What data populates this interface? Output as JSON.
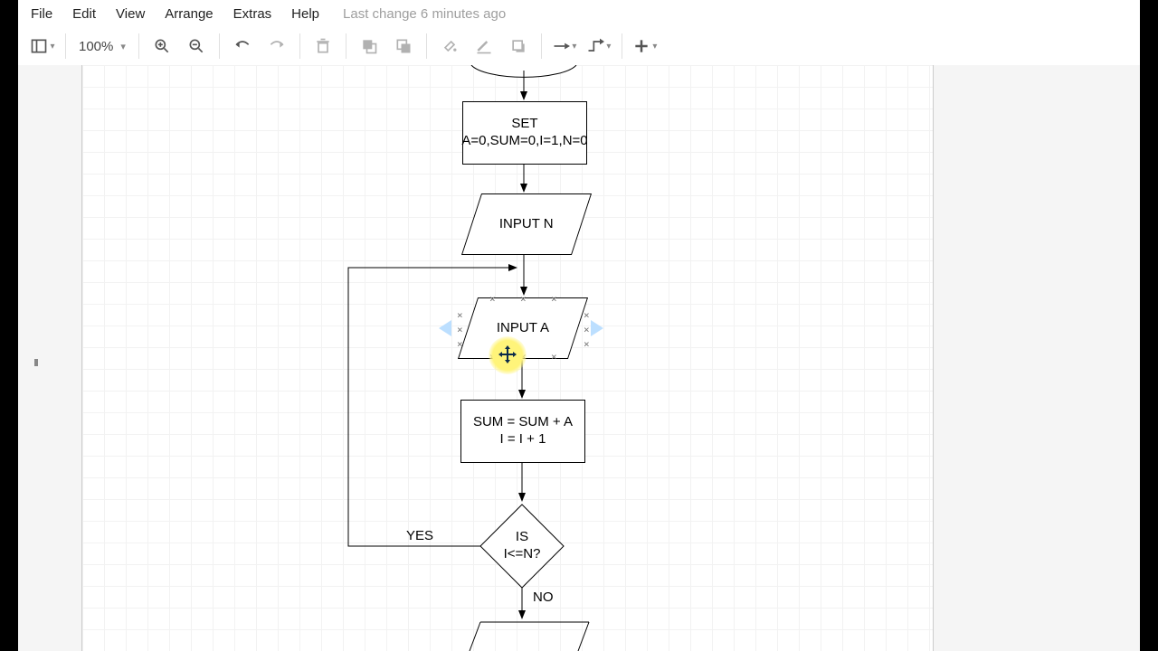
{
  "menu": {
    "file": "File",
    "edit": "Edit",
    "view": "View",
    "arrange": "Arrange",
    "extras": "Extras",
    "help": "Help",
    "status": "Last change 6 minutes ago"
  },
  "toolbar": {
    "zoom": "100%"
  },
  "diagram": {
    "set": "SET\nA=0,SUM=0,I=1,N=0",
    "inputN": "INPUT N",
    "inputA": "INPUT A",
    "sum": "SUM = SUM + A\nI = I + 1",
    "decision": "IS\nI<=N?",
    "yes": "YES",
    "no": "NO"
  }
}
